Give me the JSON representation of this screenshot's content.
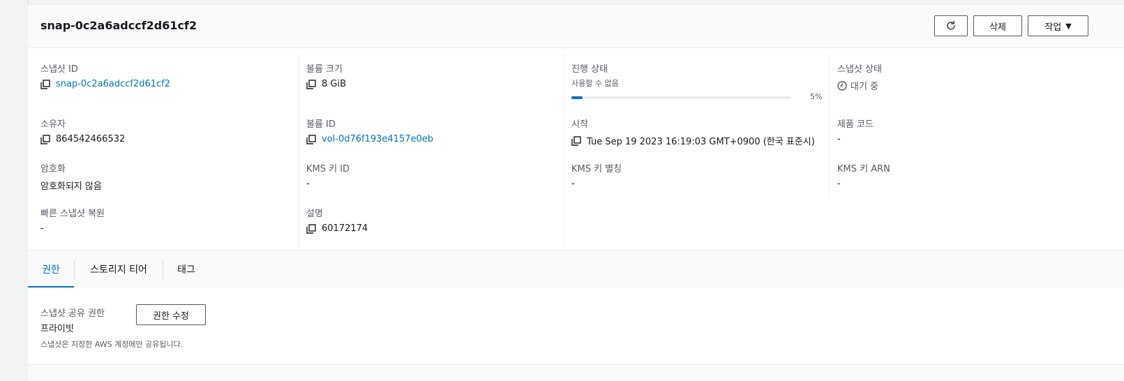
{
  "snapshot_title": "snap-0c2a6adccf2d61cf2",
  "header_buttons": {
    "delete_label": "삭제",
    "actions_label": "작업",
    "actions_caret": "▼"
  },
  "details": {
    "snapshot_id": {
      "label": "스냅샷 ID",
      "value": "snap-0c2a6adccf2d61cf2"
    },
    "owner": {
      "label": "소유자",
      "value": "864542466532"
    },
    "encryption": {
      "label": "암호화",
      "value": "암호화되지 않음"
    },
    "fast_restore": {
      "label": "빠른 스냅샷 복원",
      "value": "-"
    },
    "volume_size": {
      "label": "볼륨 크기",
      "value": "8 GiB"
    },
    "volume_id": {
      "label": "볼륨 ID",
      "value": "vol-0d76f193e4157e0eb"
    },
    "kms_key_id": {
      "label": "KMS 키 ID",
      "value": "-"
    },
    "description": {
      "label": "설명",
      "value": "60172174"
    },
    "progress": {
      "label": "진행 상태",
      "status": "사용할 수 없음",
      "percent_text": "5%",
      "percent": 5
    },
    "start_time": {
      "label": "시작",
      "value": "Tue Sep 19 2023 16:19:03 GMT+0900 (한국 표준시)"
    },
    "kms_key_alias": {
      "label": "KMS 키 별칭",
      "value": "-"
    },
    "snapshot_state": {
      "label": "스냅샷 상태",
      "value": "대기 중"
    },
    "product_code": {
      "label": "제품 코드",
      "value": "-"
    },
    "kms_key_arn": {
      "label": "KMS 키 ARN",
      "value": "-"
    }
  },
  "tabs": [
    {
      "label": "권한",
      "active": true
    },
    {
      "label": "스토리지 티어",
      "active": false
    },
    {
      "label": "태그",
      "active": false
    }
  ],
  "permissions": {
    "label": "스냅샷 공유 권한",
    "value": "프라이빗",
    "description": "스냅샷은 지정한 AWS 계정에만 공유됩니다.",
    "edit_button": "권한 수정"
  },
  "colors": {
    "link": "#0073bb",
    "progress": "#0073bb"
  }
}
